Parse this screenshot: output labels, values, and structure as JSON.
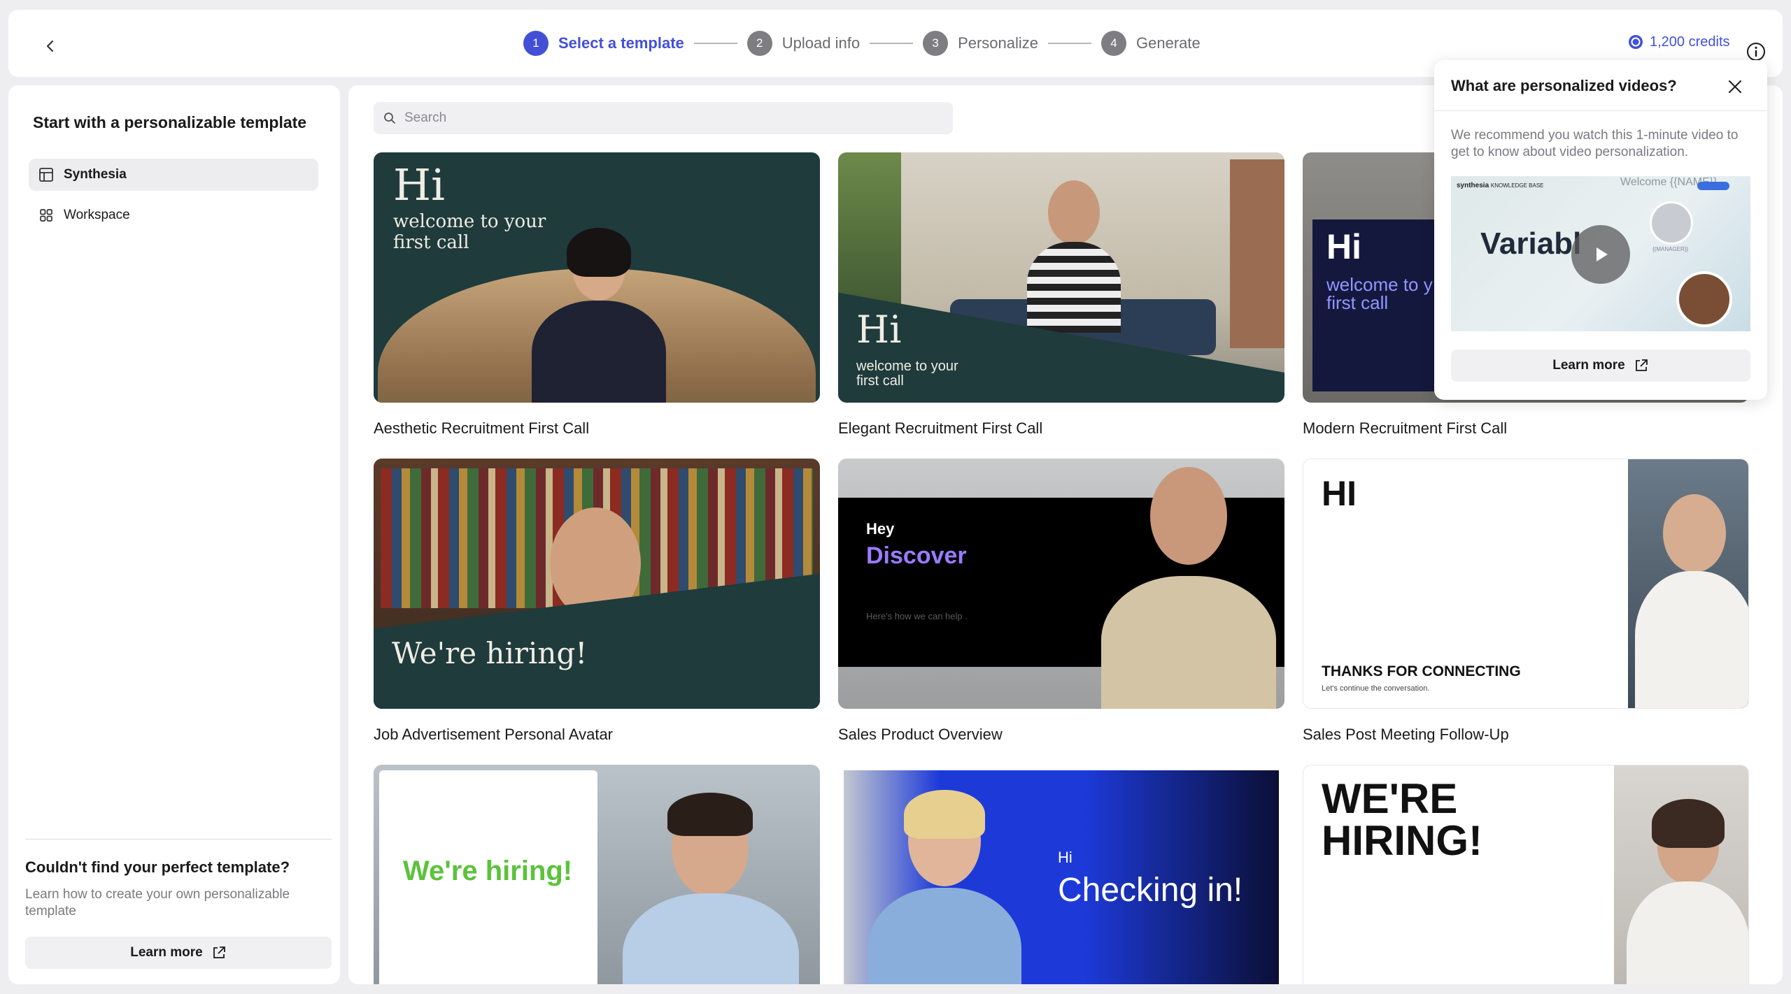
{
  "header": {
    "steps": [
      {
        "num": "1",
        "label": "Select a template"
      },
      {
        "num": "2",
        "label": "Upload info"
      },
      {
        "num": "3",
        "label": "Personalize"
      },
      {
        "num": "4",
        "label": "Generate"
      }
    ],
    "active_step": 1,
    "credits": "1,200 credits"
  },
  "sidebar": {
    "title": "Start with a personalizable template",
    "items": [
      {
        "label": "Synthesia",
        "icon": "template-icon",
        "selected": true
      },
      {
        "label": "Workspace",
        "icon": "grid-icon",
        "selected": false
      }
    ],
    "footer": {
      "title": "Couldn't find your perfect template?",
      "description": "Learn how to create your own personalizable template",
      "button": "Learn more"
    }
  },
  "search": {
    "placeholder": "Search"
  },
  "templates": [
    {
      "title": "Aesthetic Recruitment First Call",
      "thumb": {
        "big": "Hi",
        "line1": "welcome to your",
        "line2": "first call"
      }
    },
    {
      "title": "Elegant Recruitment First Call",
      "thumb": {
        "big": "Hi",
        "line1": "welcome to your",
        "line2": "first call"
      }
    },
    {
      "title": "Modern Recruitment First Call",
      "thumb": {
        "big": "Hi",
        "line1": "welcome to y",
        "line2": "first call"
      }
    },
    {
      "title": "Job Advertisement Personal Avatar",
      "thumb": {
        "big": "We're hiring!"
      }
    },
    {
      "title": "Sales Product Overview",
      "thumb": {
        "small": "Hey",
        "big": "Discover",
        "sub": "Here's how we can help ."
      }
    },
    {
      "title": "Sales Post Meeting Follow-Up",
      "thumb": {
        "big": "HI",
        "line1": "THANKS FOR CONNECTING",
        "sub": "Let's continue the conversation."
      }
    },
    {
      "title": "",
      "thumb": {
        "big": "We're hiring!"
      }
    },
    {
      "title": "",
      "thumb": {
        "small": "Hi",
        "big": "Checking in!"
      }
    },
    {
      "title": "",
      "thumb": {
        "big": "WE'RE",
        "line2": "HIRING!"
      }
    }
  ],
  "popover": {
    "title": "What are personalized videos?",
    "description": "We recommend you watch this 1-minute video to get to know about video personalization.",
    "video": {
      "brand": "synthesia",
      "brand_sub": "KNOWLEDGE BASE",
      "big": "Variabl",
      "welcome": "Welcome {{NAME}}",
      "manager": "{{MANAGER}}"
    },
    "button": "Learn more"
  },
  "colors": {
    "accent": "#4350d6",
    "dark_teal": "#1f3b3c",
    "navy": "#15183d",
    "purple": "#9a7bff",
    "green": "#5cc23c",
    "blue": "#1d3ad9"
  }
}
